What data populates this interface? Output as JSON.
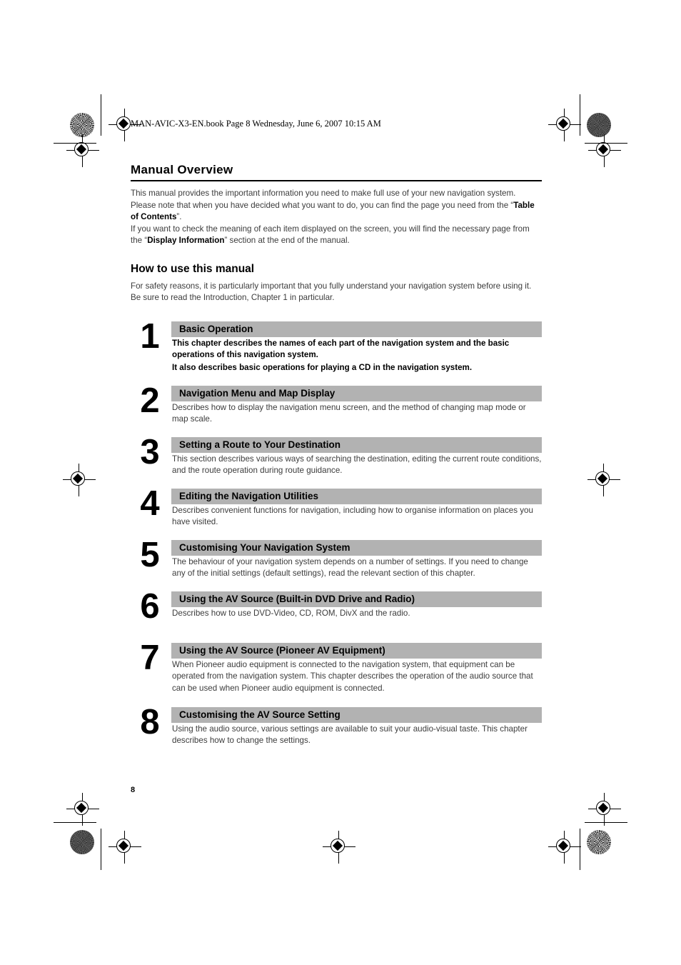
{
  "header": {
    "filestamp": "MAN-AVIC-X3-EN.book  Page 8  Wednesday, June 6, 2007  10:15 AM"
  },
  "sections": {
    "manual_overview": {
      "title": "Manual Overview",
      "para1_a": "This manual provides the important information you need to make full use of your new navigation system.",
      "para2_a": "Please note that when you have decided what you want to do, you can find the page you need from the “",
      "para2_b": "Table of Contents",
      "para2_c": "”.",
      "para3_a": "If you want to check the meaning of each item displayed on the screen, you will find the necessary page from the “",
      "para3_b": "Display Information",
      "para3_c": "” section at the end of the manual."
    },
    "how_to_use": {
      "title": "How to use this manual",
      "para": "For safety reasons, it is particularly important that you fully understand your navigation system before using it. Be sure to read the Introduction, Chapter 1 in particular."
    }
  },
  "chapters": [
    {
      "number": "1",
      "heading": "Basic Operation",
      "desc_line1": "This chapter describes the names of each part of the navigation system and the basic operations of this navigation system.",
      "desc_line2_a": "It also describes basic operations for playing a ",
      "desc_line2_b": "CD",
      "desc_line2_c": " in the navigation system.",
      "bold": true
    },
    {
      "number": "2",
      "heading": "Navigation Menu and Map Display",
      "desc_line1": "Describes how to display the navigation menu screen, and the method of changing map mode or map scale.",
      "bold": false
    },
    {
      "number": "3",
      "heading": "Setting a Route to Your Destination",
      "desc_line1": "This section describes various ways of searching the destination, editing the current route conditions, and the route operation during route guidance.",
      "bold": false
    },
    {
      "number": "4",
      "heading": "Editing the Navigation Utilities",
      "desc_line1": "Describes convenient functions for navigation, including how to organise information on places you have visited.",
      "bold": false
    },
    {
      "number": "5",
      "heading": "Customising Your Navigation System",
      "desc_line1": "The behaviour of your navigation system depends on a number of settings. If you need to change any of the initial settings (default settings), read the relevant section of this chapter.",
      "bold": false
    },
    {
      "number": "6",
      "heading": "Using the AV Source (Built-in DVD Drive and Radio)",
      "desc_line1": "Describes how to use DVD-Video, CD, ROM, DivX and the radio.",
      "bold": false
    },
    {
      "number": "7",
      "heading": "Using the AV Source (Pioneer AV Equipment)",
      "desc_line1": "When Pioneer audio equipment is connected to the navigation system, that equipment can be operated from the navigation system. This chapter describes the operation of the audio source that can be used when Pioneer audio equipment is connected.",
      "bold": false
    },
    {
      "number": "8",
      "heading": "Customising the AV Source Setting",
      "desc_line1": "Using the audio source, various settings are available to suit your audio-visual taste. This chapter describes how to change the settings.",
      "bold": false
    }
  ],
  "footer": {
    "page_number": "8"
  },
  "colors": {
    "bar_gray": "#b2b2b2",
    "body_text": "#3c3c3c",
    "heading_black": "#000000"
  }
}
